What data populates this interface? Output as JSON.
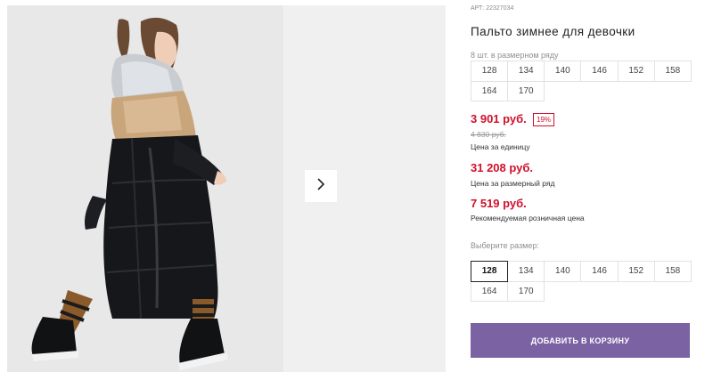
{
  "gallery": {
    "next_icon": "chevron-right-icon",
    "photo_alt": "girl-winter-coat"
  },
  "product": {
    "sku": "АРТ: 22327034",
    "title": "Пальто зимнее для девочки",
    "grid_label": "8 шт. в размерном ряду",
    "grid_sizes": [
      "128",
      "134",
      "140",
      "146",
      "152",
      "158",
      "164",
      "170"
    ],
    "price": "3 901 руб.",
    "discount": "19%",
    "old_price": "4 830 руб.",
    "price_caption": "Цена за единицу",
    "grid_price": "31 208 руб.",
    "grid_price_caption": "Цена за размерный ряд",
    "retail_price": "7 519 руб.",
    "retail_caption": "Рекомендуемая розничная цена",
    "select_label": "Выберите размер:",
    "select_sizes": [
      "128",
      "134",
      "140",
      "146",
      "152",
      "158",
      "164",
      "170"
    ],
    "selected_size": "128",
    "add_to_cart": "ДОБАВИТЬ В КОРЗИНУ"
  },
  "colors": {
    "price_red": "#d0102b",
    "cart_button": "#7a62a3"
  }
}
